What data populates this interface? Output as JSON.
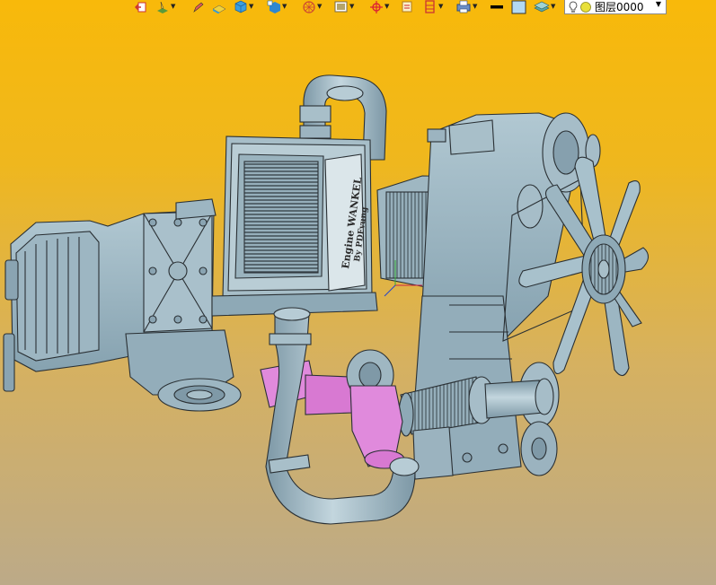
{
  "toolbar": {
    "buttons": [
      {
        "icon": "exit-icon"
      },
      {
        "icon": "layer-paint-icon",
        "has_dropdown": true
      },
      {
        "icon": "pencil-icon"
      },
      {
        "icon": "surface-patch-icon"
      },
      {
        "icon": "solid-box-icon",
        "has_dropdown": true
      },
      {
        "icon": "solid-coordinate-box-icon",
        "has_dropdown": true
      },
      {
        "icon": "wheel-rotate-icon",
        "has_dropdown": true
      },
      {
        "icon": "image-frame-icon",
        "has_dropdown": true
      },
      {
        "icon": "crosshair-icon",
        "has_dropdown": true
      },
      {
        "icon": "sheet-icon"
      },
      {
        "icon": "ruler-icon",
        "has_dropdown": true
      },
      {
        "icon": "printer-icon",
        "has_dropdown": true
      },
      {
        "icon": "line-weight-icon"
      },
      {
        "icon": "color-swatch-icon"
      },
      {
        "icon": "layer-stack-icon",
        "has_dropdown": true
      }
    ],
    "layer_combo": {
      "value": "图层0000",
      "icons": [
        "light-bulb-icon",
        "sun-icon"
      ]
    }
  },
  "viewport": {
    "background_colors": [
      "#f8b90a",
      "#bcaa88"
    ],
    "part_color": "#94aebb",
    "highlight_color": "#e08adc",
    "intercooler_label": "Engine WANKEL",
    "intercooler_sublabel": "By PDFvung"
  }
}
